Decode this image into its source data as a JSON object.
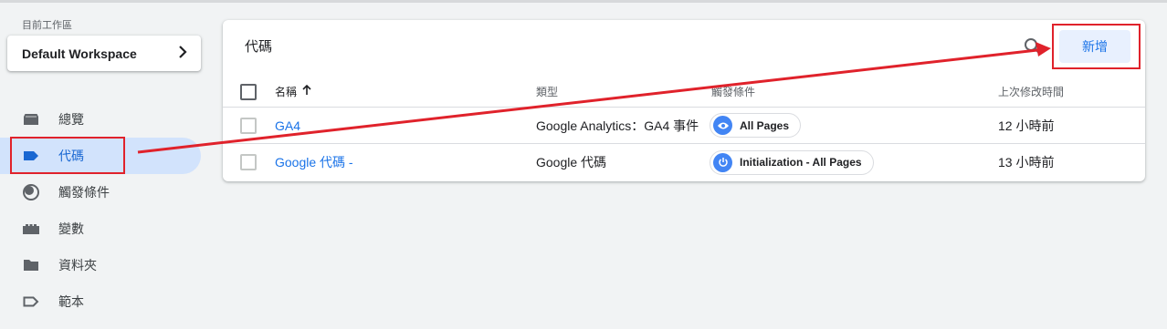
{
  "workspace": {
    "label": "目前工作區",
    "name": "Default Workspace"
  },
  "nav": {
    "items": [
      {
        "label": "總覽",
        "icon": "overview-icon"
      },
      {
        "label": "代碼",
        "icon": "tag-icon",
        "active": true
      },
      {
        "label": "觸發條件",
        "icon": "trigger-icon"
      },
      {
        "label": "變數",
        "icon": "variables-icon"
      },
      {
        "label": "資料夾",
        "icon": "folder-icon"
      },
      {
        "label": "範本",
        "icon": "template-icon"
      }
    ]
  },
  "main": {
    "title": "代碼",
    "new_label": "新增",
    "columns": {
      "name": "名稱",
      "type": "類型",
      "trigger": "觸發條件",
      "modified": "上次修改時間"
    },
    "rows": [
      {
        "name": "GA4",
        "type": "Google Analytics：GA4 事件",
        "trigger": "All Pages",
        "trigger_icon": "eye-icon",
        "modified": "12 小時前"
      },
      {
        "name": "Google 代碼 -",
        "type": "Google 代碼",
        "trigger": "Initialization - All Pages",
        "trigger_icon": "power-icon",
        "modified": "13 小時前"
      }
    ]
  },
  "colors": {
    "accent": "#1a73e8",
    "active_nav_bg": "#d2e3fc",
    "annotation_red": "#e0222b"
  }
}
